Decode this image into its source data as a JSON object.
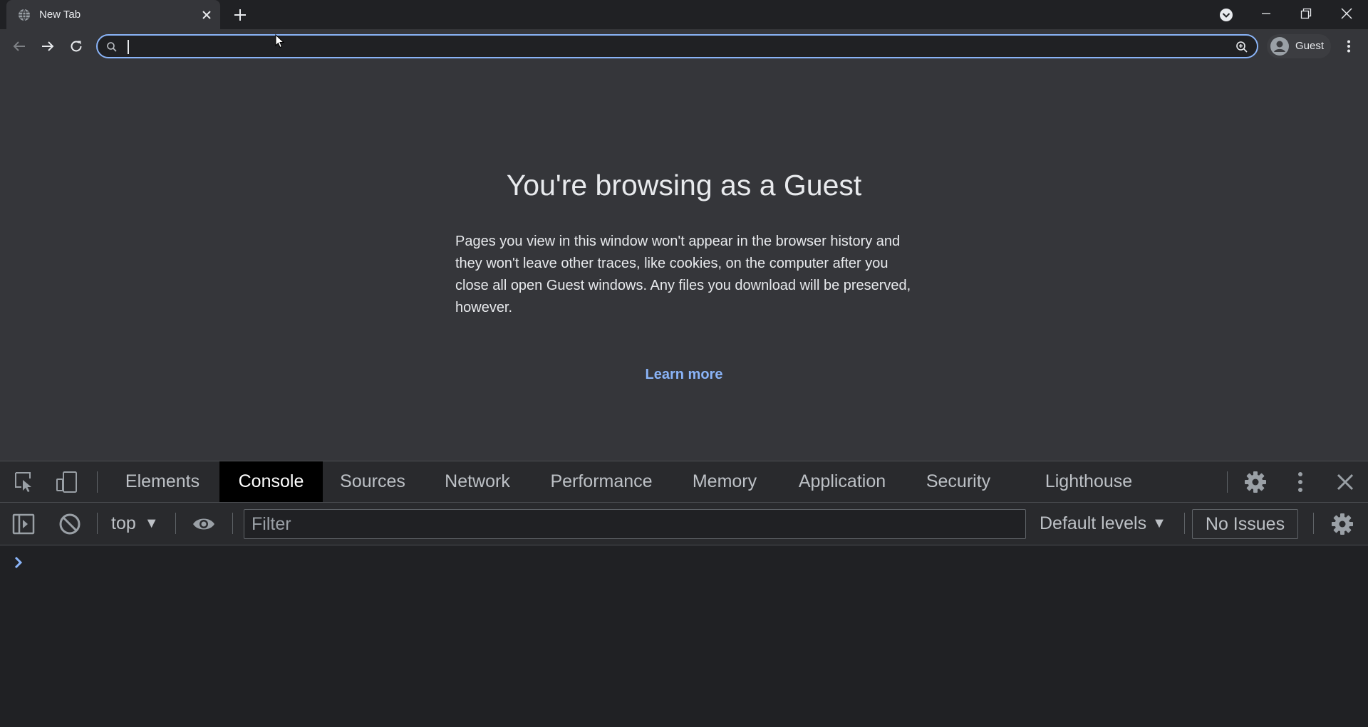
{
  "browser": {
    "tab": {
      "title": "New Tab"
    },
    "omnibox": {
      "value": "",
      "placeholder": ""
    },
    "profile": {
      "label": "Guest"
    }
  },
  "page": {
    "title": "You're browsing as a Guest",
    "description": "Pages you view in this window won't appear in the browser history and they won't leave other traces, like cookies, on the computer after you close all open Guest windows. Any files you download will be preserved, however.",
    "learn_more": "Learn more"
  },
  "devtools": {
    "tabs": [
      "Elements",
      "Console",
      "Sources",
      "Network",
      "Performance",
      "Memory",
      "Application",
      "Security",
      "Lighthouse"
    ],
    "active_tab": "Console",
    "context": "top",
    "filter_placeholder": "Filter",
    "levels": "Default levels",
    "issues": "No Issues"
  },
  "colors": {
    "accent": "#8ab4f8",
    "active_tab_bg": "#000000",
    "page_bg": "#35363a",
    "chrome_bg": "#202124"
  }
}
